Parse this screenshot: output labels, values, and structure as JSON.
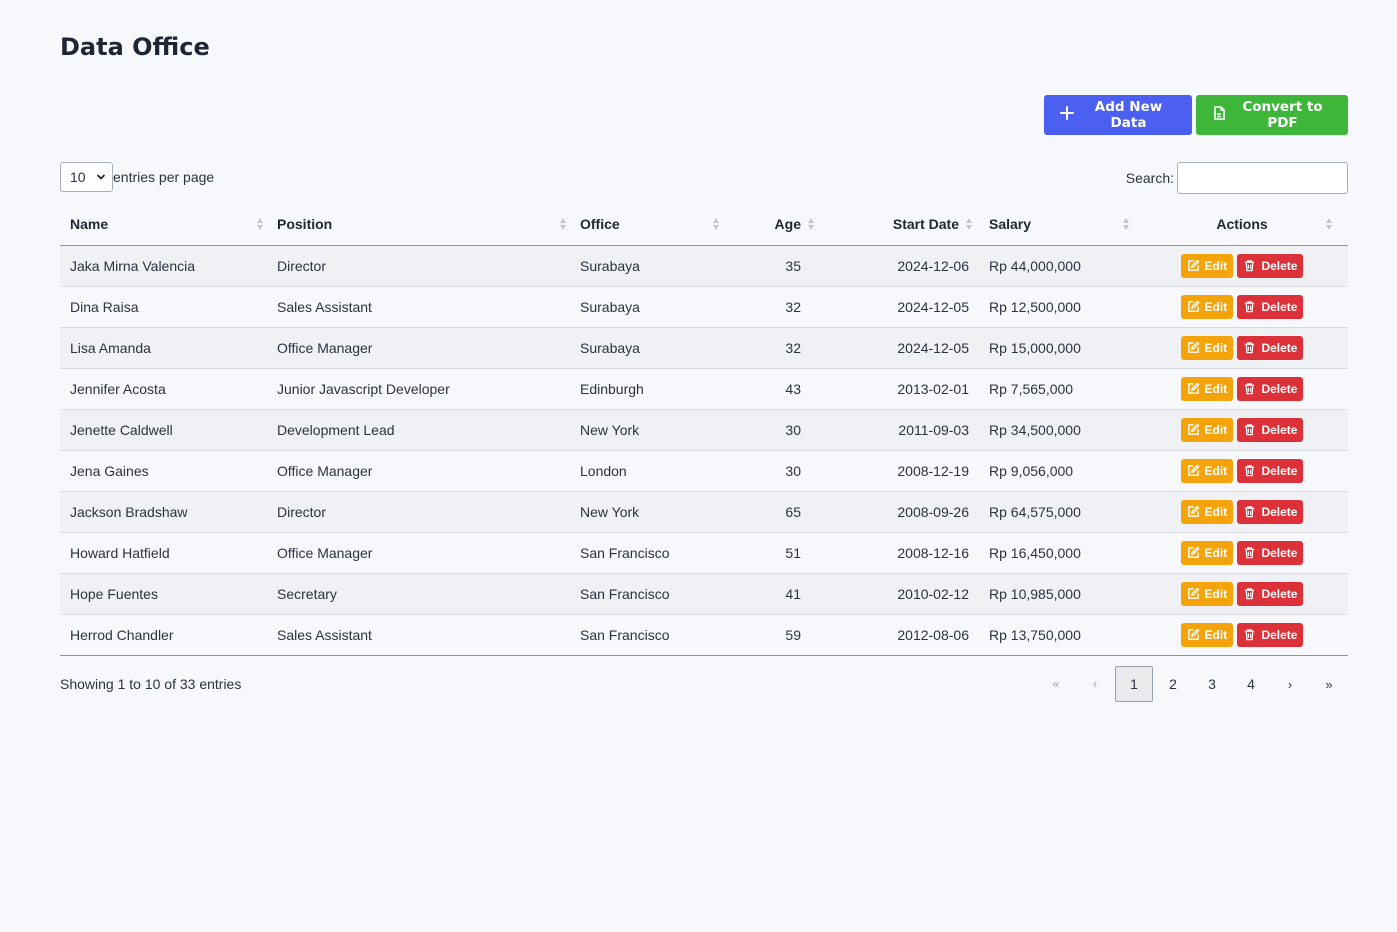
{
  "page": {
    "title": "Data Office"
  },
  "toolbar": {
    "add_label": "Add New Data",
    "pdf_label": "Convert to PDF",
    "add_color": "#4b5ff0",
    "pdf_color": "#3db63a"
  },
  "length": {
    "selected": "10",
    "label": "entries per page"
  },
  "search": {
    "label": "Search:",
    "value": "",
    "placeholder": ""
  },
  "table": {
    "columns": [
      "Name",
      "Position",
      "Office",
      "Age",
      "Start Date",
      "Salary",
      "Actions"
    ],
    "rows": [
      [
        "Jaka Mirna Valencia",
        "Director",
        "Surabaya",
        "35",
        "2024-12-06",
        "Rp 44,000,000"
      ],
      [
        "Dina Raisa",
        "Sales Assistant",
        "Surabaya",
        "32",
        "2024-12-05",
        "Rp 12,500,000"
      ],
      [
        "Lisa Amanda",
        "Office Manager",
        "Surabaya",
        "32",
        "2024-12-05",
        "Rp 15,000,000"
      ],
      [
        "Jennifer Acosta",
        "Junior Javascript Developer",
        "Edinburgh",
        "43",
        "2013-02-01",
        "Rp 7,565,000"
      ],
      [
        "Jenette Caldwell",
        "Development Lead",
        "New York",
        "30",
        "2011-09-03",
        "Rp 34,500,000"
      ],
      [
        "Jena Gaines",
        "Office Manager",
        "London",
        "30",
        "2008-12-19",
        "Rp 9,056,000"
      ],
      [
        "Jackson Bradshaw",
        "Director",
        "New York",
        "65",
        "2008-09-26",
        "Rp 64,575,000"
      ],
      [
        "Howard Hatfield",
        "Office Manager",
        "San Francisco",
        "51",
        "2008-12-16",
        "Rp 16,450,000"
      ],
      [
        "Hope Fuentes",
        "Secretary",
        "San Francisco",
        "41",
        "2010-02-12",
        "Rp 10,985,000"
      ],
      [
        "Herrod Chandler",
        "Sales Assistant",
        "San Francisco",
        "59",
        "2012-08-06",
        "Rp 13,750,000"
      ]
    ],
    "edit_label": "Edit",
    "delete_label": "Delete",
    "edit_color": "#f5a30b",
    "delete_color": "#dc3138"
  },
  "footer": {
    "info": "Showing 1 to 10 of 33 entries",
    "pagination": {
      "first": "«",
      "prev": "‹",
      "pages": [
        "1",
        "2",
        "3",
        "4"
      ],
      "active": "1",
      "next": "›",
      "last": "»"
    }
  }
}
